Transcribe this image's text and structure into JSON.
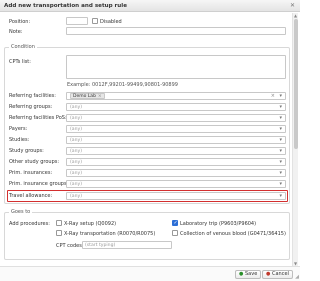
{
  "window": {
    "title": "Add new transportation and setup rule"
  },
  "top": {
    "position_label": "Position:",
    "disabled_label": "Disabled",
    "note_label": "Note:"
  },
  "condition": {
    "title": "Condition",
    "cpts_label": "CPTs list:",
    "example": "Example: 0012F,99201-99499,90801-90899",
    "rows": [
      {
        "label": "Referring facilities:",
        "value": "",
        "chip": "Demo Lab"
      },
      {
        "label": "Referring groups:",
        "value": "(any)"
      },
      {
        "label": "Referring facilities PoS:",
        "value": "(any)"
      },
      {
        "label": "Payers:",
        "value": "(any)"
      },
      {
        "label": "Studies:",
        "value": "(any)"
      },
      {
        "label": "Study groups:",
        "value": "(any)"
      },
      {
        "label": "Other study groups:",
        "value": "(any)"
      },
      {
        "label": "Prim. insurances:",
        "value": "(any)"
      },
      {
        "label": "Prim. insurance groups:",
        "value": "(any)"
      },
      {
        "label": "Travel allowance:",
        "value": "(any)"
      }
    ]
  },
  "goes_to": {
    "title": "Goes to",
    "add_procedures_label": "Add procedures:",
    "procedures": [
      {
        "label": "X-Ray setup (Q0092)",
        "checked": false
      },
      {
        "label": "Laboratory trip (P9603/P9604)",
        "checked": true
      },
      {
        "label": "X-Ray transportation (R0070/R0075)",
        "checked": false
      },
      {
        "label": "Collection of venous blood (G0471/36415)",
        "checked": false
      }
    ],
    "cpt_codes_label": "CPT codes:",
    "cpt_codes_placeholder": "(start typing)"
  },
  "footer": {
    "save_label": "Save",
    "cancel_label": "Cancel"
  }
}
